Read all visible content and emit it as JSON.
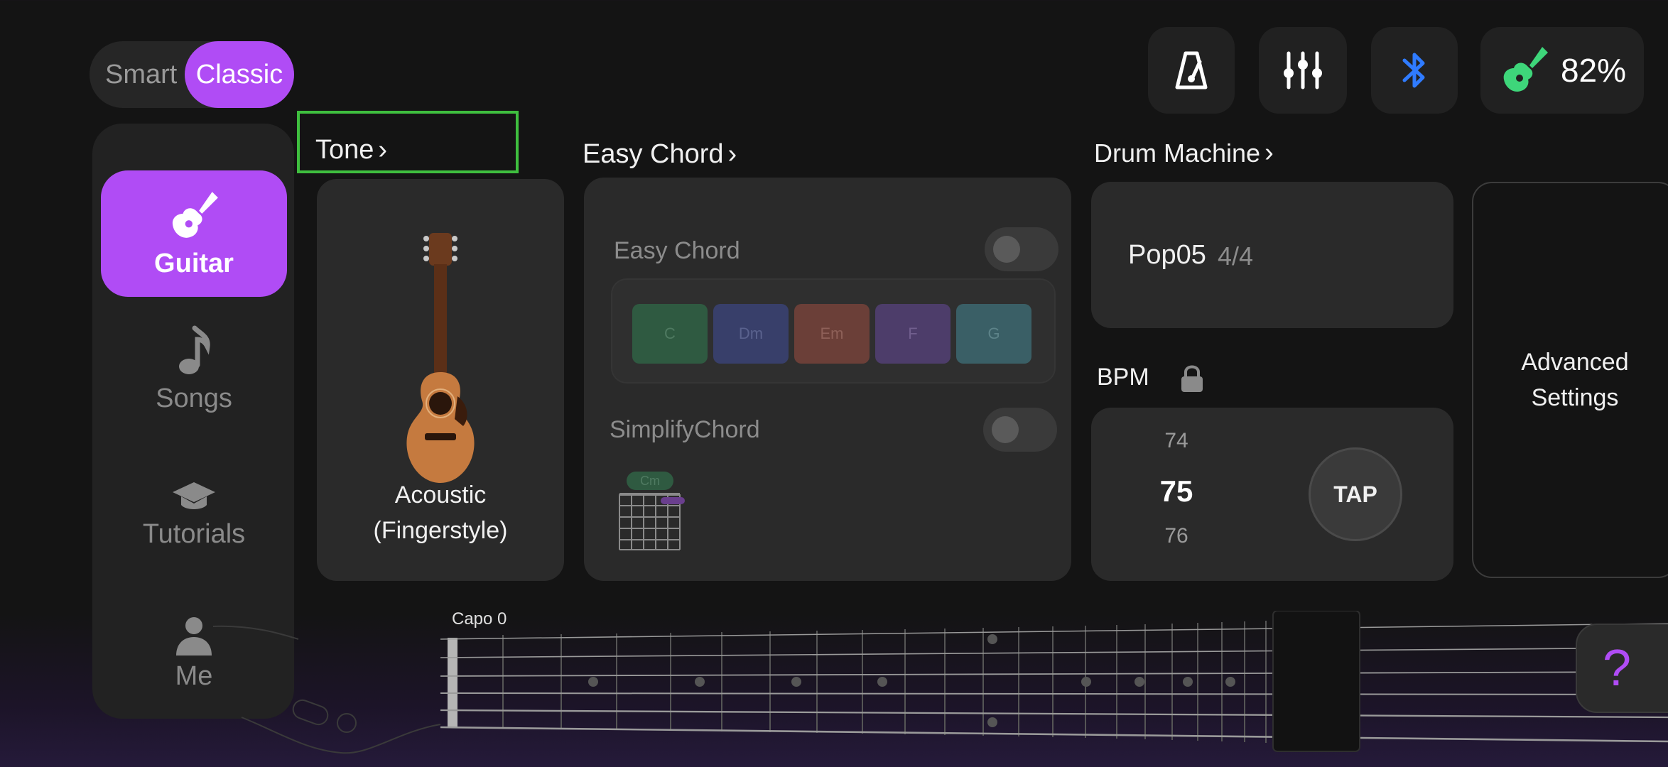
{
  "mode_toggle": {
    "smart": "Smart",
    "classic": "Classic",
    "selected": "Classic"
  },
  "top_actions": {
    "metronome_icon": "metronome-icon",
    "mixer_icon": "sliders-icon",
    "bluetooth_icon": "bluetooth-icon",
    "battery": {
      "icon": "guitar-icon",
      "percent": "82%"
    }
  },
  "sidebar": {
    "items": [
      {
        "label": "Guitar",
        "icon": "guitar-icon",
        "active": true
      },
      {
        "label": "Songs",
        "icon": "music-note-icon",
        "active": false
      },
      {
        "label": "Tutorials",
        "icon": "graduation-cap-icon",
        "active": false
      },
      {
        "label": "Me",
        "icon": "person-icon",
        "active": false
      }
    ]
  },
  "tone": {
    "title": "Tone",
    "instrument_line1": "Acoustic",
    "instrument_line2": "(Fingerstyle)"
  },
  "easy_chord": {
    "title": "Easy Chord",
    "toggle_label": "Easy Chord",
    "toggle_on": false,
    "chords": [
      "C",
      "Dm",
      "Em",
      "F",
      "G"
    ],
    "chord_colors": [
      "#2f5a41",
      "#383f6a",
      "#6b3f38",
      "#4d3d6a",
      "#3a5f66"
    ],
    "simplify_label": "SimplifyChord",
    "simplify_on": false,
    "diagram_chord": "Cm"
  },
  "drum_machine": {
    "title": "Drum Machine",
    "pattern": "Pop05",
    "time_signature": "4/4",
    "bpm_label": "BPM",
    "bpm_prev": "74",
    "bpm_value": "75",
    "bpm_next": "76",
    "tap_label": "TAP"
  },
  "advanced": {
    "line1": "Advanced",
    "line2": "Settings"
  },
  "fretboard": {
    "capo": "Capo 0"
  },
  "help": {
    "label": "?"
  },
  "colors": {
    "accent": "#b04cf5",
    "battery_green": "#3ed67a",
    "bluetooth_blue": "#2f7bff",
    "highlight_green": "#3fbf3f"
  }
}
